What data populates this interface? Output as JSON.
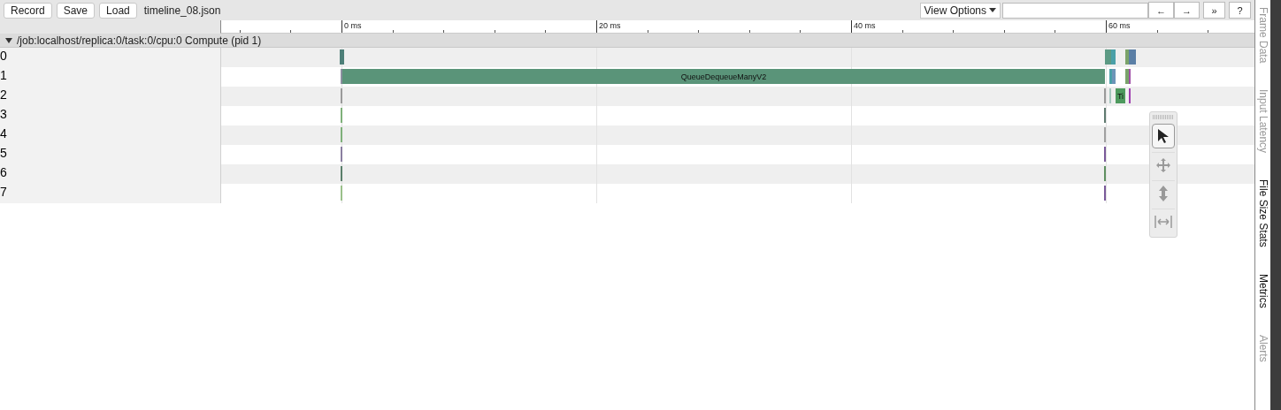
{
  "toolbar": {
    "buttons": [
      "Record",
      "Save",
      "Load"
    ],
    "filename": "timeline_08.json",
    "view_options": "View Options",
    "nav_buttons": [
      "←",
      "→",
      "»",
      "?"
    ]
  },
  "ruler": {
    "ticks": [
      "0 ms",
      "20 ms",
      "40 ms",
      "60 ms"
    ]
  },
  "process": {
    "title": "/job:localhost/replica:0/task:0/cpu:0 Compute (pid 1)",
    "expanded": true,
    "threads": [
      {
        "name": "0",
        "slices": [
          {
            "color": "#4d7f78"
          },
          {
            "color": "#5c9a84"
          },
          {
            "color": "#4aa0a8"
          },
          {
            "color": "#7aa36a"
          },
          {
            "color": "#5b7fa6"
          }
        ]
      },
      {
        "name": "1",
        "slices": [
          {
            "color": "#8b8fa0"
          },
          {
            "color": "#5a9479",
            "label": "QueueDequeueManyV2"
          },
          {
            "color": "#4aa0a8"
          },
          {
            "color": "#6d95b8"
          },
          {
            "color": "#7aa36a"
          },
          {
            "color": "#a050a8"
          }
        ]
      },
      {
        "name": "2",
        "slices": [
          {
            "color": "#9a9a9a"
          },
          {
            "color": "#9a9a9a"
          },
          {
            "color": "#a8c8c0"
          },
          {
            "color": "#4e9a5e",
            "label": "Ti"
          },
          {
            "color": "#a040b0"
          }
        ]
      },
      {
        "name": "3",
        "slices": [
          {
            "color": "#7fb07a"
          },
          {
            "color": "#607a70"
          }
        ]
      },
      {
        "name": "4",
        "slices": [
          {
            "color": "#7fb07a"
          },
          {
            "color": "#a0a0a0"
          }
        ]
      },
      {
        "name": "5",
        "slices": [
          {
            "color": "#8a7fa0"
          },
          {
            "color": "#7a5a9a"
          }
        ]
      },
      {
        "name": "6",
        "slices": [
          {
            "color": "#5a7f6a"
          },
          {
            "color": "#5f9060"
          }
        ]
      },
      {
        "name": "7",
        "slices": [
          {
            "color": "#9ac08a"
          },
          {
            "color": "#7a5a9a"
          }
        ]
      }
    ]
  },
  "tool_palette": [
    {
      "kind": "select",
      "selected": true
    },
    {
      "kind": "pan",
      "selected": false
    },
    {
      "kind": "zoom",
      "selected": false
    },
    {
      "kind": "timing",
      "selected": false
    }
  ],
  "side_tabs": [
    {
      "label": "Frame Data",
      "enabled": false
    },
    {
      "label": "Input Latency",
      "enabled": false
    },
    {
      "label": "File Size Stats",
      "enabled": true
    },
    {
      "label": "Metrics",
      "enabled": true
    },
    {
      "label": "Alerts",
      "enabled": false
    }
  ]
}
